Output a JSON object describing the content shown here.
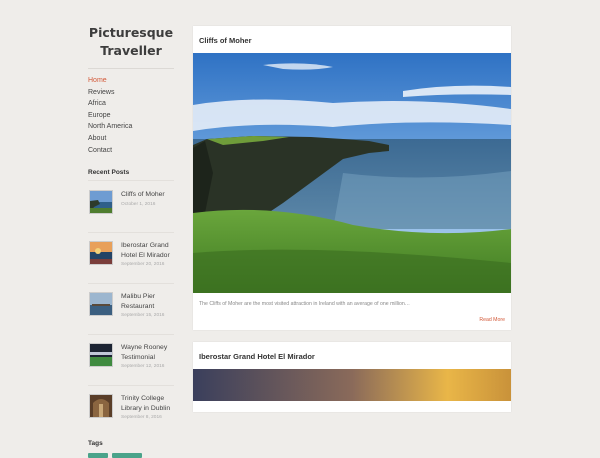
{
  "site": {
    "title_line1": "Picturesque",
    "title_line2": "Traveller"
  },
  "nav": [
    {
      "label": "Home",
      "active": true
    },
    {
      "label": "Reviews"
    },
    {
      "label": "Africa"
    },
    {
      "label": "Europe"
    },
    {
      "label": "North America"
    },
    {
      "label": "About"
    },
    {
      "label": "Contact"
    }
  ],
  "recent_posts": {
    "heading": "Recent Posts",
    "items": [
      {
        "title": "Cliffs of Moher",
        "date": "October 1, 2016"
      },
      {
        "title": "Iberostar Grand Hotel El Mirador",
        "date": "September 20, 2016"
      },
      {
        "title": "Malibu Pier Restaurant",
        "date": "September 15, 2016"
      },
      {
        "title": "Wayne Rooney Testimonial",
        "date": "September 12, 2016"
      },
      {
        "title": "Trinity College Library in Dublin",
        "date": "September 8, 2016"
      }
    ]
  },
  "tags": {
    "heading": "Tags"
  },
  "posts": [
    {
      "title": "Cliffs of Moher",
      "excerpt": "The Cliffs of Moher are the most visited attraction in Ireland with an average of one million…",
      "read_more": "Read More"
    },
    {
      "title": "Iberostar Grand Hotel El Mirador"
    }
  ],
  "colors": {
    "accent": "#d35a3a",
    "tag": "#4aa38a",
    "background": "#efedea"
  }
}
